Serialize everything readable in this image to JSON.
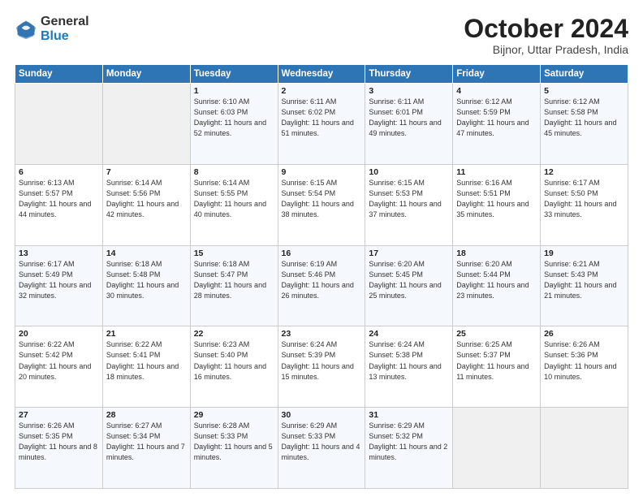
{
  "logo": {
    "general": "General",
    "blue": "Blue"
  },
  "header": {
    "title": "October 2024",
    "subtitle": "Bijnor, Uttar Pradesh, India"
  },
  "columns": [
    "Sunday",
    "Monday",
    "Tuesday",
    "Wednesday",
    "Thursday",
    "Friday",
    "Saturday"
  ],
  "weeks": [
    [
      {
        "day": "",
        "sunrise": "",
        "sunset": "",
        "daylight": ""
      },
      {
        "day": "",
        "sunrise": "",
        "sunset": "",
        "daylight": ""
      },
      {
        "day": "1",
        "sunrise": "Sunrise: 6:10 AM",
        "sunset": "Sunset: 6:03 PM",
        "daylight": "Daylight: 11 hours and 52 minutes."
      },
      {
        "day": "2",
        "sunrise": "Sunrise: 6:11 AM",
        "sunset": "Sunset: 6:02 PM",
        "daylight": "Daylight: 11 hours and 51 minutes."
      },
      {
        "day": "3",
        "sunrise": "Sunrise: 6:11 AM",
        "sunset": "Sunset: 6:01 PM",
        "daylight": "Daylight: 11 hours and 49 minutes."
      },
      {
        "day": "4",
        "sunrise": "Sunrise: 6:12 AM",
        "sunset": "Sunset: 5:59 PM",
        "daylight": "Daylight: 11 hours and 47 minutes."
      },
      {
        "day": "5",
        "sunrise": "Sunrise: 6:12 AM",
        "sunset": "Sunset: 5:58 PM",
        "daylight": "Daylight: 11 hours and 45 minutes."
      }
    ],
    [
      {
        "day": "6",
        "sunrise": "Sunrise: 6:13 AM",
        "sunset": "Sunset: 5:57 PM",
        "daylight": "Daylight: 11 hours and 44 minutes."
      },
      {
        "day": "7",
        "sunrise": "Sunrise: 6:14 AM",
        "sunset": "Sunset: 5:56 PM",
        "daylight": "Daylight: 11 hours and 42 minutes."
      },
      {
        "day": "8",
        "sunrise": "Sunrise: 6:14 AM",
        "sunset": "Sunset: 5:55 PM",
        "daylight": "Daylight: 11 hours and 40 minutes."
      },
      {
        "day": "9",
        "sunrise": "Sunrise: 6:15 AM",
        "sunset": "Sunset: 5:54 PM",
        "daylight": "Daylight: 11 hours and 38 minutes."
      },
      {
        "day": "10",
        "sunrise": "Sunrise: 6:15 AM",
        "sunset": "Sunset: 5:53 PM",
        "daylight": "Daylight: 11 hours and 37 minutes."
      },
      {
        "day": "11",
        "sunrise": "Sunrise: 6:16 AM",
        "sunset": "Sunset: 5:51 PM",
        "daylight": "Daylight: 11 hours and 35 minutes."
      },
      {
        "day": "12",
        "sunrise": "Sunrise: 6:17 AM",
        "sunset": "Sunset: 5:50 PM",
        "daylight": "Daylight: 11 hours and 33 minutes."
      }
    ],
    [
      {
        "day": "13",
        "sunrise": "Sunrise: 6:17 AM",
        "sunset": "Sunset: 5:49 PM",
        "daylight": "Daylight: 11 hours and 32 minutes."
      },
      {
        "day": "14",
        "sunrise": "Sunrise: 6:18 AM",
        "sunset": "Sunset: 5:48 PM",
        "daylight": "Daylight: 11 hours and 30 minutes."
      },
      {
        "day": "15",
        "sunrise": "Sunrise: 6:18 AM",
        "sunset": "Sunset: 5:47 PM",
        "daylight": "Daylight: 11 hours and 28 minutes."
      },
      {
        "day": "16",
        "sunrise": "Sunrise: 6:19 AM",
        "sunset": "Sunset: 5:46 PM",
        "daylight": "Daylight: 11 hours and 26 minutes."
      },
      {
        "day": "17",
        "sunrise": "Sunrise: 6:20 AM",
        "sunset": "Sunset: 5:45 PM",
        "daylight": "Daylight: 11 hours and 25 minutes."
      },
      {
        "day": "18",
        "sunrise": "Sunrise: 6:20 AM",
        "sunset": "Sunset: 5:44 PM",
        "daylight": "Daylight: 11 hours and 23 minutes."
      },
      {
        "day": "19",
        "sunrise": "Sunrise: 6:21 AM",
        "sunset": "Sunset: 5:43 PM",
        "daylight": "Daylight: 11 hours and 21 minutes."
      }
    ],
    [
      {
        "day": "20",
        "sunrise": "Sunrise: 6:22 AM",
        "sunset": "Sunset: 5:42 PM",
        "daylight": "Daylight: 11 hours and 20 minutes."
      },
      {
        "day": "21",
        "sunrise": "Sunrise: 6:22 AM",
        "sunset": "Sunset: 5:41 PM",
        "daylight": "Daylight: 11 hours and 18 minutes."
      },
      {
        "day": "22",
        "sunrise": "Sunrise: 6:23 AM",
        "sunset": "Sunset: 5:40 PM",
        "daylight": "Daylight: 11 hours and 16 minutes."
      },
      {
        "day": "23",
        "sunrise": "Sunrise: 6:24 AM",
        "sunset": "Sunset: 5:39 PM",
        "daylight": "Daylight: 11 hours and 15 minutes."
      },
      {
        "day": "24",
        "sunrise": "Sunrise: 6:24 AM",
        "sunset": "Sunset: 5:38 PM",
        "daylight": "Daylight: 11 hours and 13 minutes."
      },
      {
        "day": "25",
        "sunrise": "Sunrise: 6:25 AM",
        "sunset": "Sunset: 5:37 PM",
        "daylight": "Daylight: 11 hours and 11 minutes."
      },
      {
        "day": "26",
        "sunrise": "Sunrise: 6:26 AM",
        "sunset": "Sunset: 5:36 PM",
        "daylight": "Daylight: 11 hours and 10 minutes."
      }
    ],
    [
      {
        "day": "27",
        "sunrise": "Sunrise: 6:26 AM",
        "sunset": "Sunset: 5:35 PM",
        "daylight": "Daylight: 11 hours and 8 minutes."
      },
      {
        "day": "28",
        "sunrise": "Sunrise: 6:27 AM",
        "sunset": "Sunset: 5:34 PM",
        "daylight": "Daylight: 11 hours and 7 minutes."
      },
      {
        "day": "29",
        "sunrise": "Sunrise: 6:28 AM",
        "sunset": "Sunset: 5:33 PM",
        "daylight": "Daylight: 11 hours and 5 minutes."
      },
      {
        "day": "30",
        "sunrise": "Sunrise: 6:29 AM",
        "sunset": "Sunset: 5:33 PM",
        "daylight": "Daylight: 11 hours and 4 minutes."
      },
      {
        "day": "31",
        "sunrise": "Sunrise: 6:29 AM",
        "sunset": "Sunset: 5:32 PM",
        "daylight": "Daylight: 11 hours and 2 minutes."
      },
      {
        "day": "",
        "sunrise": "",
        "sunset": "",
        "daylight": ""
      },
      {
        "day": "",
        "sunrise": "",
        "sunset": "",
        "daylight": ""
      }
    ]
  ]
}
